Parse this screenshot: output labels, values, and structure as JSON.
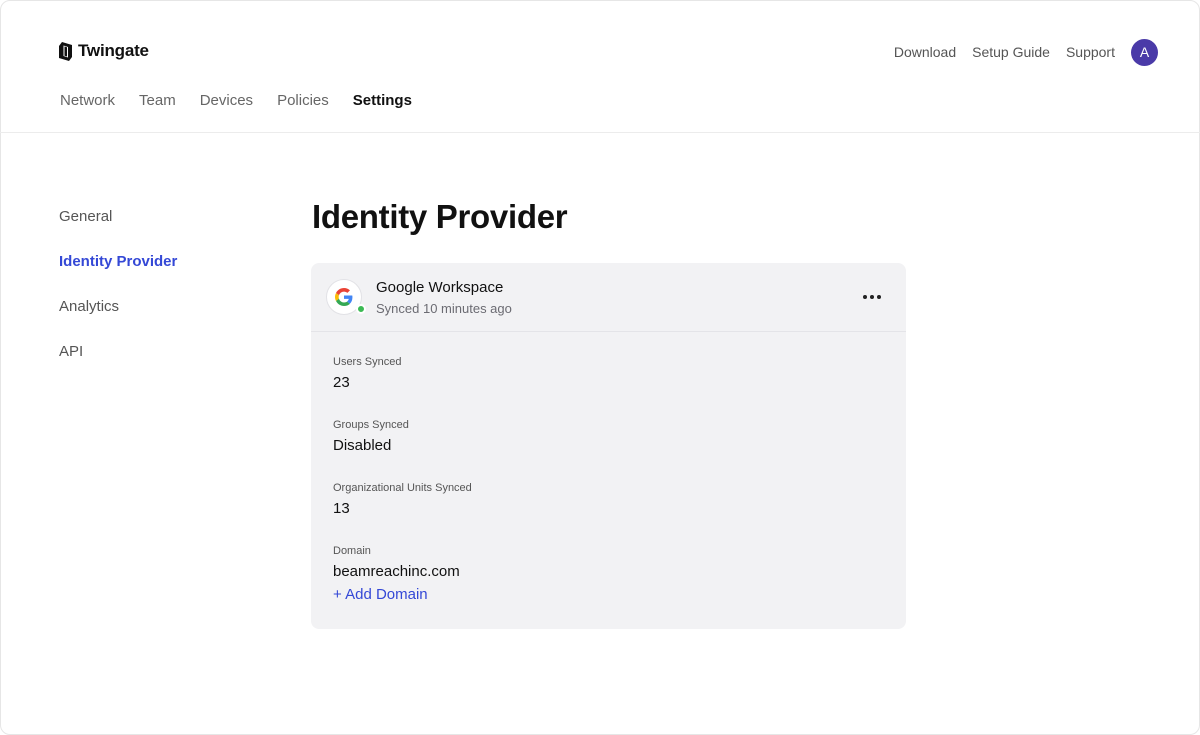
{
  "brand": {
    "name": "Twingate"
  },
  "utility_nav": {
    "download": "Download",
    "setup_guide": "Setup Guide",
    "support": "Support",
    "avatar_initial": "A"
  },
  "main_nav": {
    "tabs": [
      "Network",
      "Team",
      "Devices",
      "Policies",
      "Settings"
    ],
    "active": "Settings"
  },
  "side_nav": {
    "items": [
      "General",
      "Identity Provider",
      "Analytics",
      "API"
    ],
    "active": "Identity Provider"
  },
  "page": {
    "title": "Identity Provider"
  },
  "provider": {
    "name": "Google Workspace",
    "status": "Synced 10 minutes ago",
    "icon": "google-icon",
    "fields": [
      {
        "label": "Users Synced",
        "value": "23"
      },
      {
        "label": "Groups Synced",
        "value": "Disabled"
      },
      {
        "label": "Organizational Units Synced",
        "value": "13"
      },
      {
        "label": "Domain",
        "value": "beamreachinc.com"
      }
    ],
    "add_domain": "+ Add Domain"
  },
  "colors": {
    "accent": "#3448d6",
    "avatar": "#4a3aa8",
    "status_ok": "#3cba54",
    "card_bg": "#f2f2f4"
  }
}
